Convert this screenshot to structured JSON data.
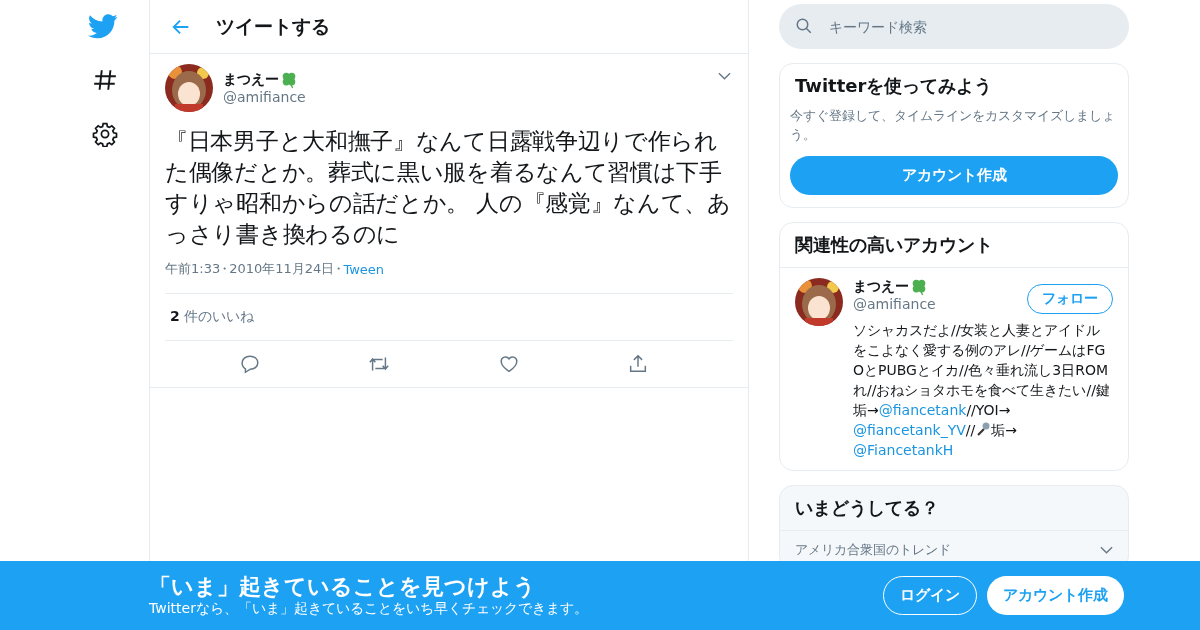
{
  "header": {
    "title": "ツイートする"
  },
  "tweet": {
    "name": "まつえー",
    "handle": "@amifiance",
    "text": "『日本男子と大和撫子』なんて日露戦争辺りで作られた偶像だとか。葬式に黒い服を着るなんて習慣は下手すりゃ昭和からの話だとか。 人の『感覚』なんて、あっさり書き換わるのに",
    "time": "午前1:33",
    "date": "2010年11月24日",
    "source": "Tween",
    "separator": "・",
    "likes_count": "2",
    "likes_label": "件のいいね"
  },
  "search": {
    "placeholder": "キーワード検索"
  },
  "signup_card": {
    "title": "Twitterを使ってみよう",
    "text": "今すぐ登録して、タイムラインをカスタマイズしましょう。",
    "button": "アカウント作成"
  },
  "related": {
    "title": "関連性の高いアカウント",
    "name": "まつえー",
    "handle": "@amifiance",
    "follow": "フォロー",
    "bio": [
      {
        "kind": "text",
        "text": "ソシャカスだよ//女装と人妻とアイドルをこよなく愛する例のアレ//ゲームはFGOとPUBGとイカ//色々垂れ流し3日ROMれ//おねショタホモを食べて生きたい//鍵垢→"
      },
      {
        "kind": "link",
        "text": "@fiancetank"
      },
      {
        "kind": "text",
        "text": "//YOI→"
      },
      {
        "kind": "link",
        "text": "@fiancetank_YV"
      },
      {
        "kind": "text",
        "text": "//"
      },
      {
        "kind": "mic"
      },
      {
        "kind": "text",
        "text": "垢→"
      },
      {
        "kind": "link",
        "text": "@FiancetankH"
      }
    ]
  },
  "trends": {
    "title": "いまどうしてる？",
    "subtitle": "アメリカ合衆国のトレンド"
  },
  "banner": {
    "title": "「いま」起きていることを見つけよう",
    "text": "Twitterなら、「いま」起きていることをいち早くチェックできます。",
    "login": "ログイン",
    "signup": "アカウント作成"
  }
}
